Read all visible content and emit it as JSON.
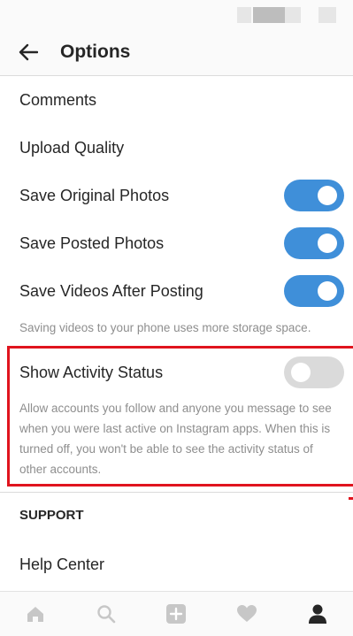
{
  "header": {
    "title": "Options",
    "back_icon": "arrow-left-icon"
  },
  "settings": {
    "comments_label": "Comments",
    "upload_quality_label": "Upload Quality",
    "save_original_photos": {
      "label": "Save Original Photos",
      "enabled": true
    },
    "save_posted_photos": {
      "label": "Save Posted Photos",
      "enabled": true
    },
    "save_videos_after_posting": {
      "label": "Save Videos After Posting",
      "enabled": true
    },
    "videos_hint": "Saving videos to your phone uses more storage space.",
    "show_activity_status": {
      "label": "Show Activity Status",
      "enabled": false
    },
    "activity_hint": "Allow accounts you follow and anyone you message to see when you were last active on Instagram apps. When this is turned off, you won't be able to see the activity status of other accounts."
  },
  "support": {
    "section_title": "SUPPORT",
    "help_center_label": "Help Center"
  },
  "tab_bar": {
    "icons": [
      "home-icon",
      "search-icon",
      "add-post-icon",
      "heart-icon",
      "profile-icon"
    ],
    "active": "profile-icon"
  },
  "colors": {
    "toggle_on": "#3f8fd9",
    "toggle_off": "#dadada",
    "highlight": "#e0141e",
    "hint_text": "#8e8e8e"
  }
}
